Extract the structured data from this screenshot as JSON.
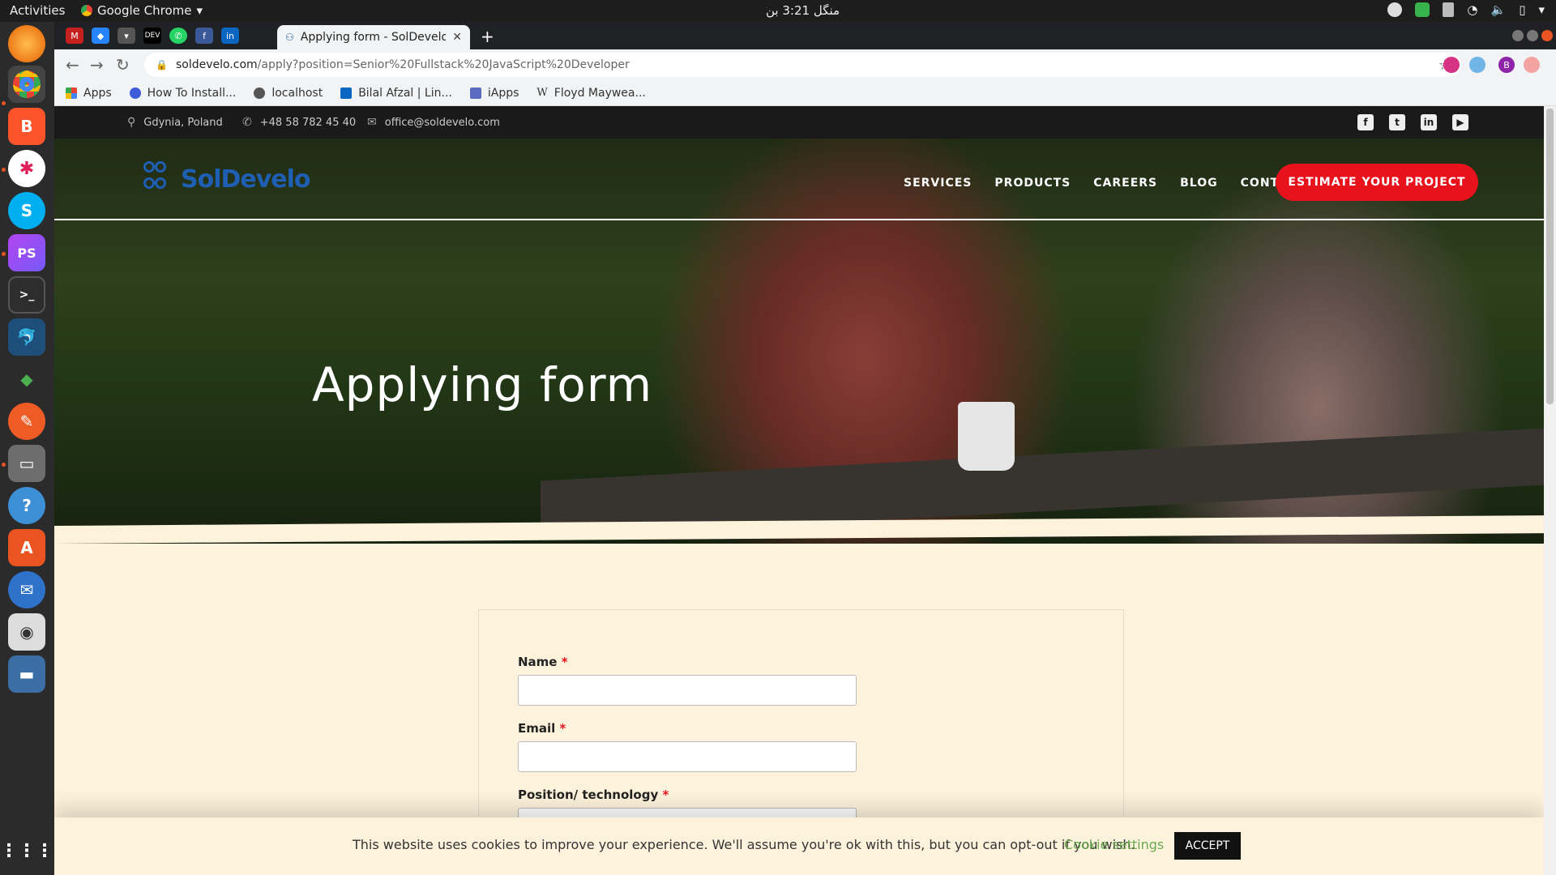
{
  "system": {
    "activities": "Activities",
    "app_name": "Google Chrome",
    "clock": "منگل 3:21 بن"
  },
  "browser": {
    "active_tab_title": "Applying form - SolDevelo",
    "url_domain": "soldevelo.com",
    "url_path": "/apply?position=Senior%20Fullstack%20JavaScript%20Developer",
    "profile_initial": "B",
    "pinned_tabs": [
      "gmail",
      "jira",
      "pocket",
      "DEV",
      "whatsapp",
      "facebook",
      "in"
    ],
    "bookmarks": [
      "Apps",
      "How To Install...",
      "localhost",
      "Bilal Afzal | Lin...",
      "iApps",
      "Floyd Maywea..."
    ]
  },
  "site": {
    "info": {
      "location": "Gdynia, Poland",
      "phone": "+48 58 782 45 40",
      "email": "office@soldevelo.com"
    },
    "logo_text": "SolDevelo",
    "nav": [
      "SERVICES",
      "PRODUCTS",
      "CAREERS",
      "BLOG",
      "CONTACT"
    ],
    "cta": "ESTIMATE YOUR PROJECT",
    "hero_title": "Applying form",
    "form": {
      "name_label": "Name",
      "email_label": "Email",
      "position_label": "Position/ technology",
      "required_mark": "*"
    },
    "cookie": {
      "message": "This website uses cookies to improve your experience. We'll assume you're ok with this, but you can opt-out if you wish.",
      "settings": "Cookie settings",
      "accept": "ACCEPT"
    }
  },
  "colors": {
    "accent_red": "#e8121c",
    "page_bg": "#fdf3dc",
    "logo_blue": "#1f5fb3"
  }
}
